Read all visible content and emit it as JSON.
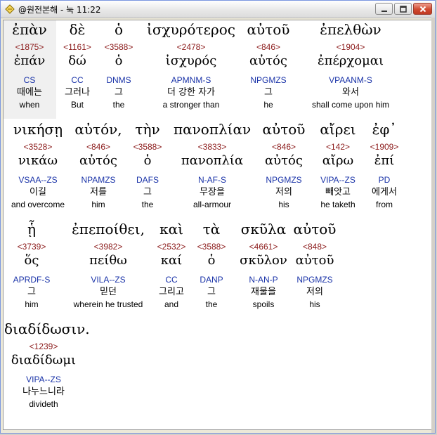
{
  "window": {
    "title": "@원전본해 - 눅 11:22",
    "minimize_label": "",
    "maximize_label": "",
    "close_label": ""
  },
  "lines": [
    {
      "words": [
        {
          "greek": "ἐπὰν",
          "strong": "<1875>",
          "lemma": "ἐπάν",
          "parse": "CS",
          "korean": "때에는",
          "english": "when",
          "highlight": true
        },
        {
          "greek": "δὲ",
          "strong": "<1161>",
          "lemma": "δώ",
          "parse": "CC",
          "korean": "그러나",
          "english": "But"
        },
        {
          "greek": "ὁ",
          "strong": "<3588>",
          "lemma": "ὁ",
          "parse": "DNMS",
          "korean": "그",
          "english": "the"
        },
        {
          "greek": "ἰσχυρότερος",
          "strong": "<2478>",
          "lemma": "ἰσχυρός",
          "parse": "APMNM-S",
          "korean": "더 강한 자가",
          "english": "a stronger than"
        },
        {
          "greek": "αὐτοῦ",
          "strong": "<846>",
          "lemma": "αὐτός",
          "parse": "NPGMZS",
          "korean": "그",
          "english": "he"
        },
        {
          "greek": "ἐπελθὼν",
          "strong": "<1904>",
          "lemma": "ἐπέρχομαι",
          "parse": "VPAANM-S",
          "korean": "와서",
          "english": "shall come upon him"
        }
      ]
    },
    {
      "words": [
        {
          "greek": "νικήσῃ",
          "strong": "<3528>",
          "lemma": "νικάω",
          "parse": "VSAA--ZS",
          "korean": "이길",
          "english": "and overcome"
        },
        {
          "greek": "αὐτόν,",
          "strong": "<846>",
          "lemma": "αὐτός",
          "parse": "NPAMZS",
          "korean": "저를",
          "english": "him"
        },
        {
          "greek": "τὴν",
          "strong": "<3588>",
          "lemma": "ὁ",
          "parse": "DAFS",
          "korean": "그",
          "english": "the"
        },
        {
          "greek": "πανοπλίαν",
          "strong": "<3833>",
          "lemma": "πανοπλία",
          "parse": "N-AF-S",
          "korean": "무장을",
          "english": "all-armour"
        },
        {
          "greek": "αὐτοῦ",
          "strong": "<846>",
          "lemma": "αὐτός",
          "parse": "NPGMZS",
          "korean": "저의",
          "english": "his"
        },
        {
          "greek": "αἴρει",
          "strong": "<142>",
          "lemma": "αἴρω",
          "parse": "VIPA--ZS",
          "korean": "빼앗고",
          "english": "he taketh"
        },
        {
          "greek": "ἐφ᾽",
          "strong": "<1909>",
          "lemma": "ἐπί",
          "parse": "PD",
          "korean": "에게서",
          "english": "from"
        }
      ]
    },
    {
      "words": [
        {
          "greek": "ᾗ",
          "strong": "<3739>",
          "lemma": "ὅς",
          "parse": "APRDF-S",
          "korean": "그",
          "english": "him"
        },
        {
          "greek": "ἐπεποίθει,",
          "strong": "<3982>",
          "lemma": "πείθω",
          "parse": "VILA--ZS",
          "korean": "믿던",
          "english": "wherein he trusted"
        },
        {
          "greek": "καὶ",
          "strong": "<2532>",
          "lemma": "καί",
          "parse": "CC",
          "korean": "그리고",
          "english": "and"
        },
        {
          "greek": "τὰ",
          "strong": "<3588>",
          "lemma": "ὁ",
          "parse": "DANP",
          "korean": "그",
          "english": "the"
        },
        {
          "greek": "σκῦλα",
          "strong": "<4661>",
          "lemma": "σκῦλον",
          "parse": "N-AN-P",
          "korean": "재물을",
          "english": "spoils"
        },
        {
          "greek": "αὐτοῦ",
          "strong": "<848>",
          "lemma": "αὐτοῦ",
          "parse": "NPGMZS",
          "korean": "저의",
          "english": "his"
        }
      ]
    },
    {
      "words": [
        {
          "greek": "διαδίδωσιν.",
          "strong": "<1239>",
          "lemma": "διαδίδωμι",
          "parse": "VIPA--ZS",
          "korean": "나누느니라",
          "english": "divideth"
        }
      ]
    }
  ]
}
